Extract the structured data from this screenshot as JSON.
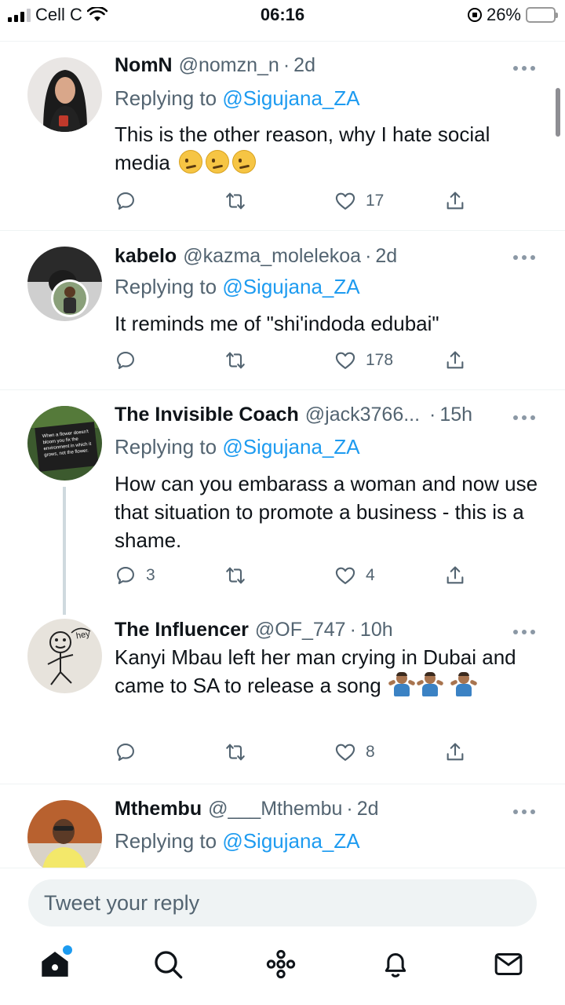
{
  "status_bar": {
    "carrier": "Cell C",
    "time": "06:16",
    "battery": "26%",
    "battery_level": 0.26
  },
  "tweets": [
    {
      "name": "NomN",
      "handle": "@nomzn_n",
      "time": "2d",
      "replying_prefix": "Replying to",
      "replying_to": "@Sigujana_ZA",
      "text": "This is the other reason, why I hate social media",
      "emoji": [
        "woozy-face",
        "woozy-face",
        "woozy-face"
      ],
      "replies": "",
      "retweets": "",
      "likes": "17"
    },
    {
      "name": "kabelo",
      "handle": "@kazma_molelekoa",
      "time": "2d",
      "replying_prefix": "Replying to",
      "replying_to": "@Sigujana_ZA",
      "text": "It reminds me of \"shi'indoda edubai\"",
      "replies": "",
      "retweets": "",
      "likes": "178"
    },
    {
      "name": "The Invisible Coach",
      "handle": "@jack3766...",
      "time": "15h",
      "replying_prefix": "Replying to",
      "replying_to": "@Sigujana_ZA",
      "text": "How can you embarass a woman and now use that situation to promote a business - this is a shame.",
      "avatar_text": "When a flower doesn't bloom you fix the environment in which it grows, not the flower.",
      "replies": "3",
      "retweets": "",
      "likes": "4"
    },
    {
      "name": "The Influencer",
      "handle": "@OF_747",
      "time": "10h",
      "text": "Kanyi Mbau left her man crying in Dubai and came to SA to release a song",
      "emoji": [
        "person-shrugging",
        "person-shrugging",
        "person-shrugging"
      ],
      "avatar_text": "hey",
      "replies": "",
      "retweets": "",
      "likes": "8"
    },
    {
      "name": "Mthembu",
      "handle": "@___Mthembu",
      "time": "2d",
      "replying_prefix": "Replying to",
      "replying_to": "@Sigujana_ZA"
    }
  ],
  "composer": {
    "placeholder": "Tweet your reply"
  },
  "tab_bar": {
    "items": [
      "home-icon",
      "search-icon",
      "spaces-icon",
      "notifications-icon",
      "messages-icon"
    ]
  },
  "colors": {
    "accent": "#1d9bf0",
    "text": "#0f1419",
    "secondary": "#536471",
    "divider": "#eff3f4"
  }
}
